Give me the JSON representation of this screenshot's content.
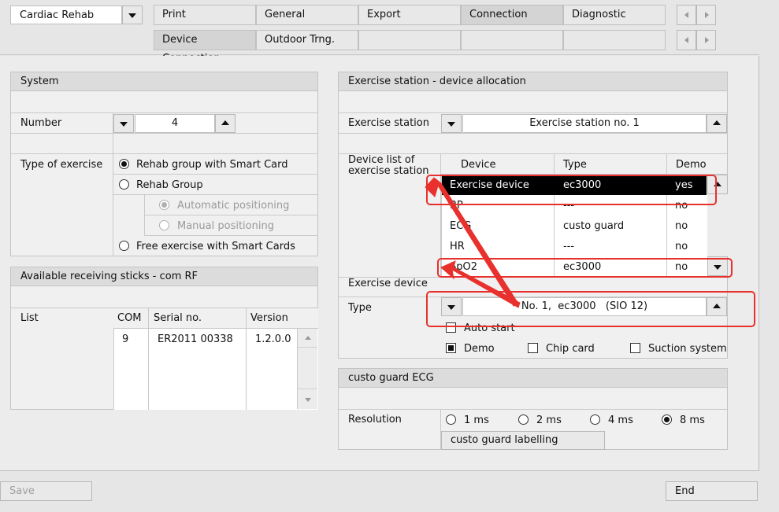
{
  "top": {
    "app_selector": "Cardiac Rehab",
    "tabs_row1": [
      "Print",
      "General",
      "Export",
      "Connection",
      "Diagnostic"
    ],
    "tabs_row2": [
      "Device Connection",
      "Outdoor Trng.",
      "",
      "",
      ""
    ]
  },
  "system": {
    "title": "System",
    "number_label": "Number",
    "number_value": "4",
    "type_label": "Type of exercise",
    "options": {
      "rehab_smart": "Rehab group with Smart Card",
      "rehab_group": "Rehab Group",
      "auto_pos": "Automatic positioning",
      "manual_pos": "Manual positioning",
      "free_ex": "Free exercise with Smart Cards"
    }
  },
  "sticks": {
    "title": "Available receiving sticks - com RF",
    "list_label": "List",
    "columns": [
      "COM",
      "Serial no.",
      "Version"
    ],
    "rows": [
      {
        "com": "9",
        "serial": "ER2011 00338",
        "version": "1.2.0.0"
      }
    ]
  },
  "allocation": {
    "title": "Exercise station - device allocation",
    "station_label": "Exercise station",
    "station_value": "Exercise station no. 1",
    "device_list_label": "Device list of exercise station",
    "columns": [
      "Device",
      "Type",
      "Demo"
    ],
    "rows": [
      {
        "device": "Exercise device",
        "type": "ec3000",
        "demo": "yes"
      },
      {
        "device": "BP",
        "type": "---",
        "demo": "no"
      },
      {
        "device": "ECG",
        "type": "custo guard",
        "demo": "no"
      },
      {
        "device": "HR",
        "type": "---",
        "demo": "no"
      },
      {
        "device": "SpO2",
        "type": "ec3000",
        "demo": "no"
      }
    ],
    "exercise_device_label": "Exercise device",
    "type_label": "Type",
    "type_value": "No. 1,  ec3000   (SIO 12)",
    "auto_start": "Auto start",
    "demo": "Demo",
    "chip_card": "Chip card",
    "suction": "Suction system"
  },
  "ecg": {
    "title": "custo guard ECG",
    "resolution_label": "Resolution",
    "resolutions": [
      "1 ms",
      "2 ms",
      "4 ms",
      "8 ms"
    ],
    "labelling_button": "custo guard labelling"
  },
  "footer": {
    "save": "Save",
    "end": "End"
  },
  "colors": {
    "highlight": "#e8312d",
    "selected_row": "#000000"
  }
}
